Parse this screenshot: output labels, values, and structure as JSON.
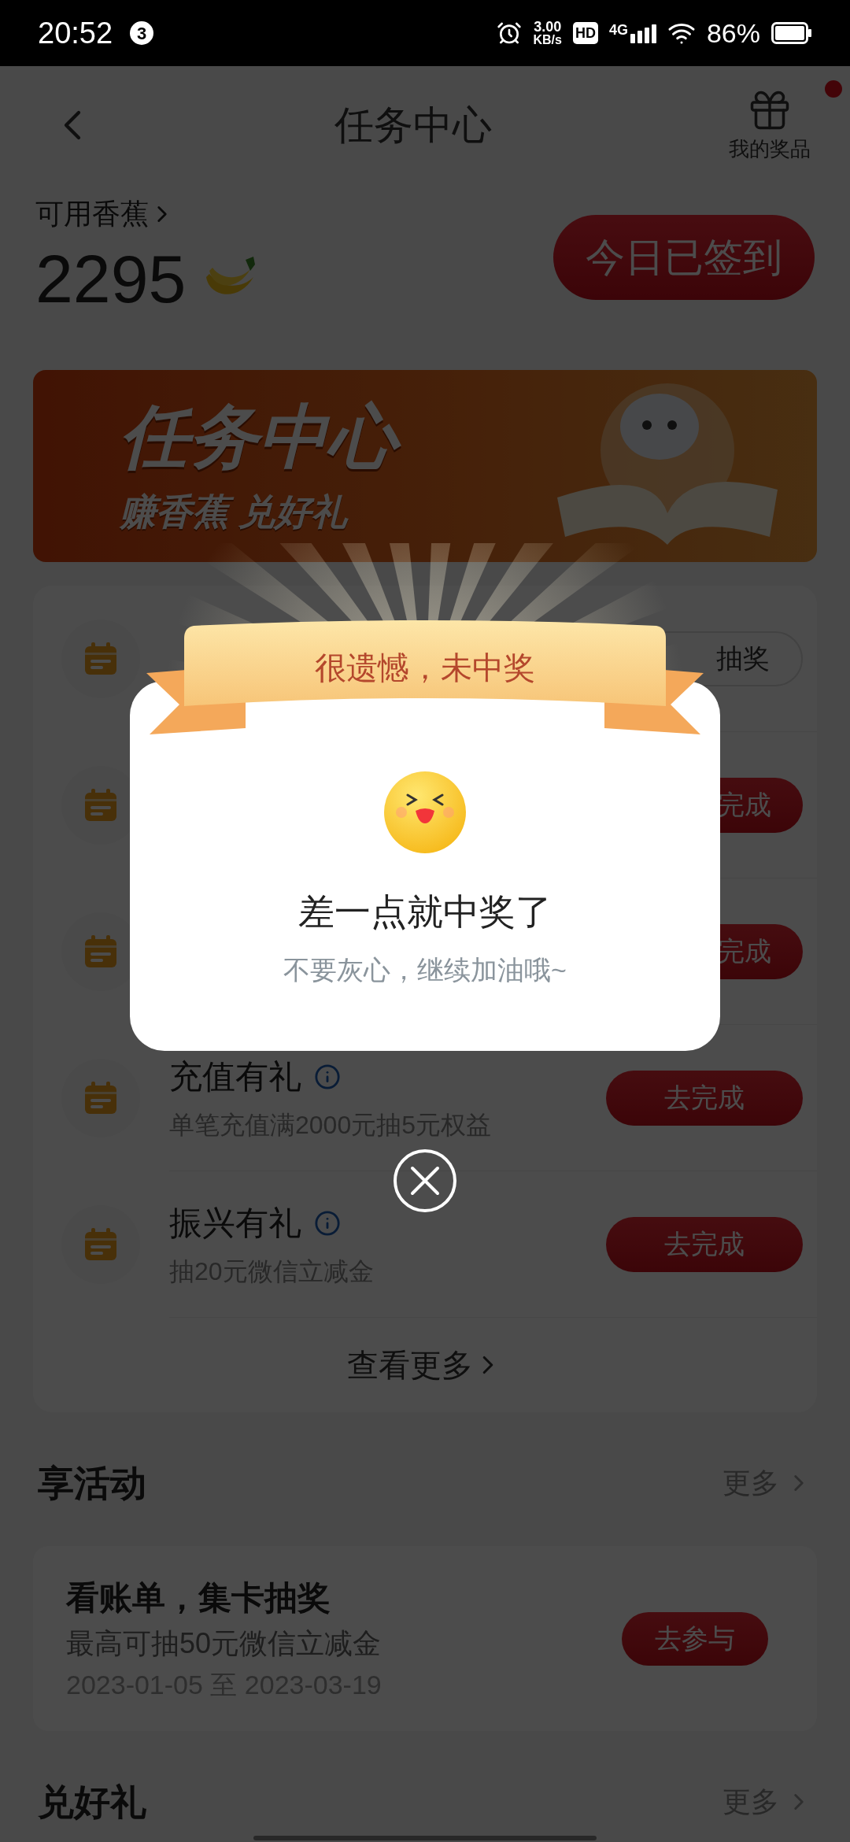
{
  "status_bar": {
    "time": "20:52",
    "notification_count": "3",
    "net_speed_value": "3.00",
    "net_speed_unit": "KB/s",
    "hd": "HD",
    "network": "4G",
    "battery": "86%"
  },
  "header": {
    "title": "任务中心",
    "prizes_label": "我的奖品",
    "prizes_badge": true
  },
  "points": {
    "label": "可用香蕉",
    "value": "2295",
    "checkin_button": "今日已签到"
  },
  "banner": {
    "title": "任务中心",
    "subtitle": "赚香蕉 兑好礼"
  },
  "tasks": [
    {
      "button": "抽奖",
      "kind": "outline"
    },
    {
      "button": "完成",
      "kind": "filled"
    },
    {
      "button": "完成",
      "kind": "filled"
    },
    {
      "title": "充值有礼",
      "subtitle": "单笔充值满2000元抽5元权益",
      "button": "去完成",
      "kind": "filled"
    },
    {
      "title": "振兴有礼",
      "subtitle": "抽20元微信立减金",
      "button": "去完成",
      "kind": "filled"
    }
  ],
  "tasks_more": "查看更多",
  "activities": {
    "heading": "享活动",
    "more": "更多",
    "items": [
      {
        "title": "看账单，集卡抽奖",
        "subtitle": "最高可抽50元微信立减金",
        "dates": "2023-01-05 至 2023-03-19",
        "button": "去参与"
      }
    ]
  },
  "gifts": {
    "heading": "兑好礼",
    "more": "更多"
  },
  "dialog": {
    "ribbon": "很遗憾，未中奖",
    "title": "差一点就中奖了",
    "message": "不要灰心，继续加油哦~"
  }
}
